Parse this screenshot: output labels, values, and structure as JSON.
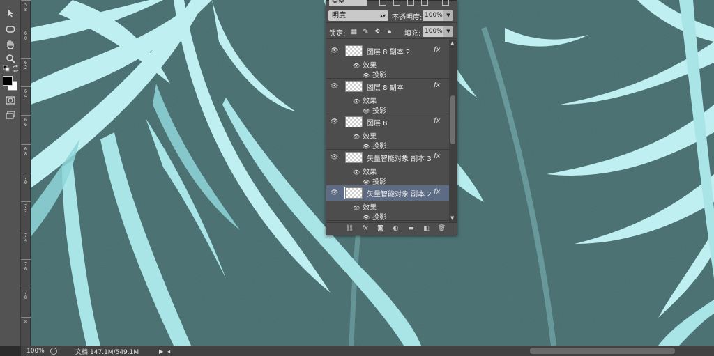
{
  "toolbar": {
    "tools": [
      "move-arrow-icon",
      "marquee-icon",
      "hand-icon",
      "zoom-icon",
      "swap-colors-icon",
      "quickmask-icon",
      "screen-mode-icon"
    ],
    "foreground_color": "#000000",
    "background_color": "#ffffff"
  },
  "ruler": {
    "labels": [
      "5\n8",
      "6\n0",
      "6\n2",
      "6\n4",
      "6\n6",
      "6\n8",
      "7\n0",
      "7\n2",
      "7\n4",
      "7\n6",
      "7\n8",
      "8"
    ]
  },
  "canvas": {
    "background": "#466c6e",
    "leaf_light": "#bfeff0",
    "leaf_mid": "#8fd6d9",
    "leaf_shadow": "#6faeb0"
  },
  "layers_panel": {
    "kind_filter": "类型",
    "blend_mode": "明度",
    "opacity_label": "不透明度:",
    "opacity_value": "100%",
    "lock_label": "锁定:",
    "fill_label": "填充:",
    "fill_value": "100%",
    "layers": [
      {
        "name": "图层 8 副本 2",
        "effects_label": "效果",
        "effect": "投影",
        "selected": false
      },
      {
        "name": "图层 8 副本",
        "effects_label": "效果",
        "effect": "投影",
        "selected": false
      },
      {
        "name": "图层 8",
        "effects_label": "效果",
        "effect": "投影",
        "selected": false
      },
      {
        "name": "矢量智能对象 副本 3",
        "effects_label": "效果",
        "effect": "投影",
        "selected": false
      },
      {
        "name": "矢量智能对象 副本 2",
        "effects_label": "效果",
        "effect": "投影",
        "selected": true
      }
    ],
    "fx_label": "fx"
  },
  "statusbar": {
    "zoom": "100%",
    "doc_info": "文档:147.1M/549.1M"
  }
}
